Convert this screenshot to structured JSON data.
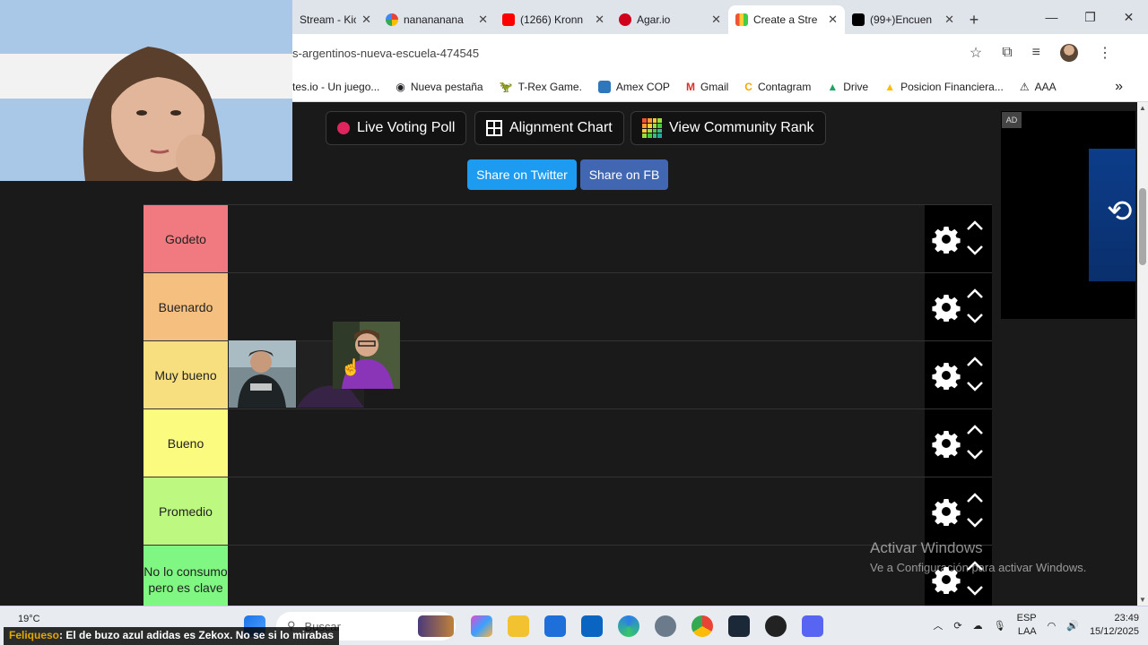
{
  "browser": {
    "tabs": [
      {
        "label": "Stream - Kic",
        "favicon": "#53fc18",
        "active": false
      },
      {
        "label": "nanananana",
        "favicon": "google",
        "active": false
      },
      {
        "label": "(1266) Kronn",
        "favicon": "#ff0000",
        "active": false
      },
      {
        "label": "Agar.io",
        "favicon": "#d0021b",
        "active": false
      },
      {
        "label": "Create a Stre",
        "favicon": "#1a1a1a",
        "active": true
      },
      {
        "label": "(99+)Encuen",
        "favicon": "#000000",
        "active": false
      }
    ],
    "new_tab": "+",
    "url": "s-argentinos-nueva-escuela-474545",
    "bookmarks": [
      "tes.io - Un juego...",
      "Nueva pestaña",
      "T-Rex Game.",
      "Amex COP",
      "Gmail",
      "Contagram",
      "Drive",
      "Posicion Financiera...",
      "AAA"
    ]
  },
  "toolbar": {
    "live_poll": "Live Voting Poll",
    "alignment": "Alignment Chart",
    "community": "View Community Rank",
    "share_twitter": "Share on Twitter",
    "share_fb": "Share on FB"
  },
  "tiers": [
    {
      "label": "Godeto",
      "color": "#f07a7f"
    },
    {
      "label": "Buenardo",
      "color": "#f5bf80"
    },
    {
      "label": "Muy bueno",
      "color": "#f7df80"
    },
    {
      "label": "Bueno",
      "color": "#fbfb80"
    },
    {
      "label": "Promedio",
      "color": "#bdf880"
    },
    {
      "label": "No lo consumo pero es clave",
      "color": "#80f782"
    }
  ],
  "ad": {
    "badge": "AD"
  },
  "watermark": {
    "line1": "Activar Windows",
    "line2": "Ve a Configuración para activar Windows."
  },
  "taskbar": {
    "search_placeholder": "Buscar",
    "weather_temp": "19°C",
    "lang": "ESP",
    "lang2": "LAA",
    "time": "23:49",
    "date": "15/12/2025"
  },
  "caption": {
    "who": "Feliqueso",
    "text": ": El de buzo azul adidas es Zekox. No se si lo mirabas"
  }
}
